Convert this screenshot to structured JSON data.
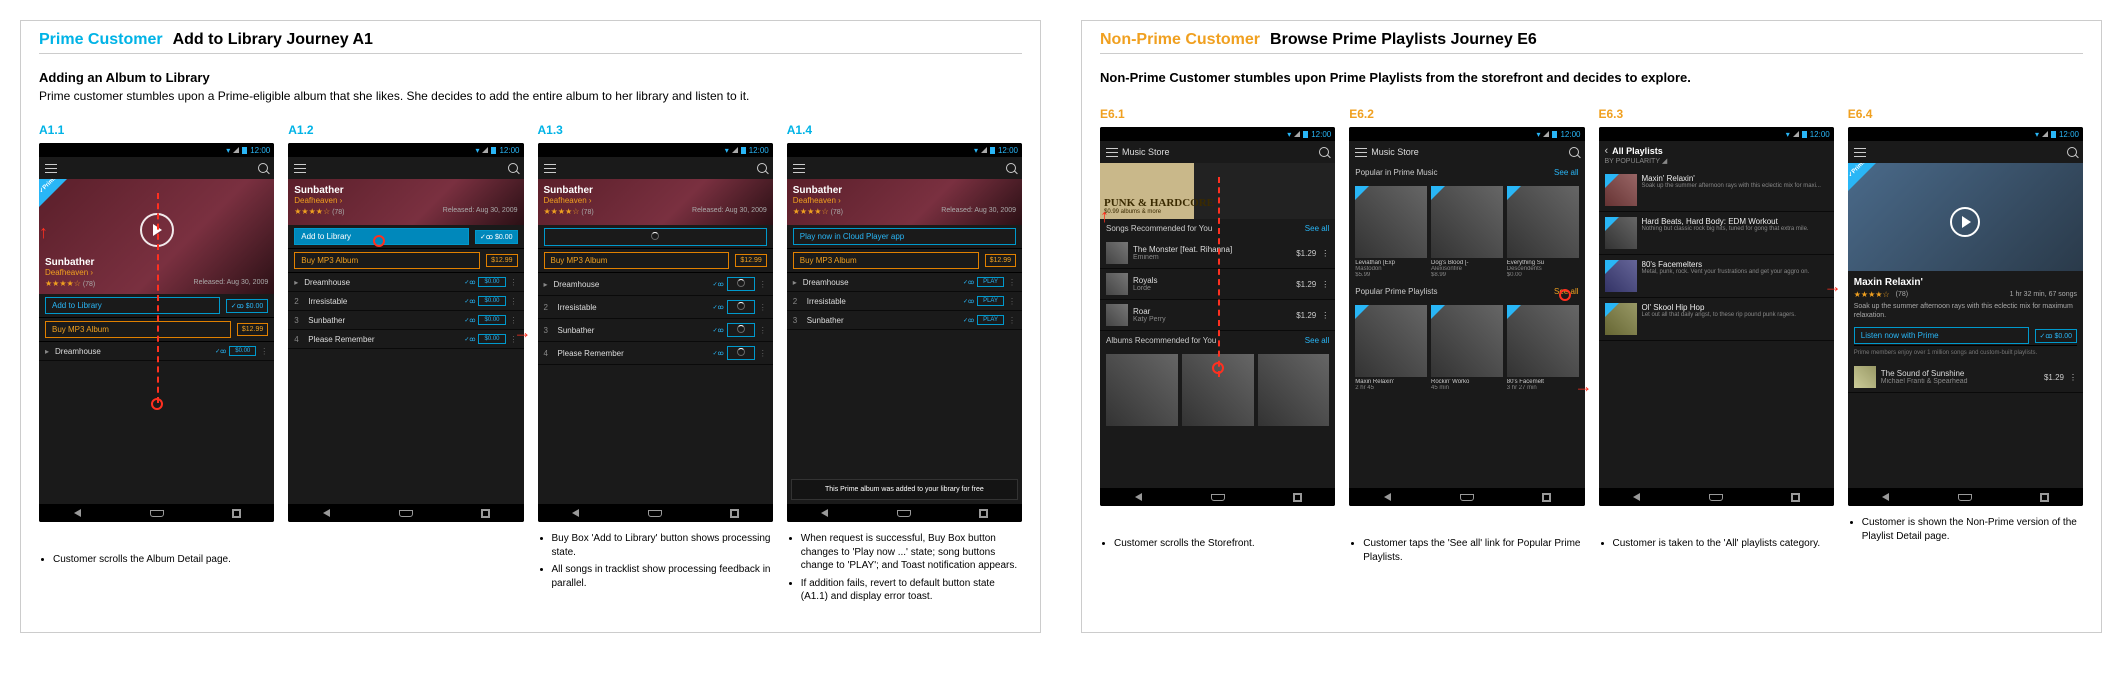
{
  "left": {
    "persona": "Prime Customer",
    "journey": "Add to Library Journey A1",
    "sub_heading": "Adding an Album to Library",
    "sub_desc": "Prime customer stumbles upon a Prime-eligible album that she likes. She decides to add the entire album to her library and listen to it.",
    "status_time": "12:00",
    "album": {
      "title": "Sunbather",
      "artist": "Deafheaven ›",
      "rating_count": "(78)",
      "released": "Released: Aug 30, 2009"
    },
    "add_to_library": "Add to Library",
    "buy_mp3": "Buy MP3 Album",
    "play_now": "Play now in Cloud Player app",
    "free_price": "$0.00",
    "album_price": "$12.99",
    "track_btn_price": "$0.00",
    "track_btn_play": "PLAY",
    "tracks": [
      "Dreamhouse",
      "Irresistable",
      "Sunbather",
      "Please Remember"
    ],
    "toast": "This Prime album was added to your library for free",
    "screens": [
      {
        "id": "A1.1",
        "notes": [
          "Customer scrolls the Album Detail page."
        ]
      },
      {
        "id": "A1.2",
        "notes": []
      },
      {
        "id": "A1.3",
        "notes": [
          "Buy Box 'Add to Library' button shows processing state.",
          "All songs in tracklist show processing feedback in parallel."
        ]
      },
      {
        "id": "A1.4",
        "notes": [
          "When request is successful, Buy Box button changes to 'Play now ...' state; song buttons change to 'PLAY'; and Toast notification appears.",
          "If addition fails, revert to default button state (A1.1) and display error toast."
        ]
      }
    ]
  },
  "right": {
    "persona": "Non-Prime Customer",
    "journey": "Browse Prime Playlists Journey E6",
    "sub_desc": "Non-Prime Customer stumbles upon Prime Playlists from the storefront and decides to explore.",
    "status_time": "12:00",
    "store_title": "Music Store",
    "banner_title": "PUNK & HARDCORE",
    "banner_sub": "$0.99 albums & more",
    "sec_songs_rec": "Songs Recommended for You",
    "sec_albums_rec": "Albums Recommended for You",
    "sec_popular_prime_music": "Popular in Prime Music",
    "sec_popular_prime_pl": "Popular Prime Playlists",
    "see_all": "See all",
    "songs": [
      {
        "t": "The Monster [feat. Rihanna]",
        "a": "Eminem",
        "p": "$1.29"
      },
      {
        "t": "Royals",
        "a": "Lorde",
        "p": "$1.29"
      },
      {
        "t": "Roar",
        "a": "Katy Perry",
        "p": "$1.29"
      }
    ],
    "prime_music_cards": [
      {
        "t": "Leviathan [Exp",
        "a": "Mastodon",
        "p": "$5.99"
      },
      {
        "t": "Dog's Blood [-",
        "a": "Alexisonfire",
        "p": "$8.99"
      },
      {
        "t": "Everything Su",
        "a": "Descendents",
        "p": "$0.00"
      }
    ],
    "prime_pl_cards": [
      {
        "t": "Maxin Relaxin'",
        "a": "2 hr 45"
      },
      {
        "t": "Rockin' Worko",
        "a": "45 min"
      },
      {
        "t": "80's Facemelt",
        "a": "3 hr 27 min"
      }
    ],
    "all_pl_title": "All Playlists",
    "all_pl_sort": "BY POPULARITY ◢",
    "playlists": [
      {
        "t": "Maxin' Relaxin'",
        "d": "Soak up the summer afternoon rays with this eclectic mix for maxi..."
      },
      {
        "t": "Hard Beats, Hard Body: EDM Workout",
        "d": "Nothing but classic rock big hits, tuned for gong that extra mile."
      },
      {
        "t": "80's Facemelters",
        "d": "Metal, punk, rock. Vent your frustrations and get your aggro on."
      },
      {
        "t": "Ol' Skool Hip Hop",
        "d": "Let out all that daily angst, to these rip pound punk ragers."
      }
    ],
    "detail": {
      "title": "Maxin Relaxin'",
      "rating_count": "(78)",
      "length": "1 hr 32 min, 67 songs",
      "desc": "Soak up the summer afternoon rays with this eclectic mix for maximum relaxation.",
      "cta": "Listen now with Prime",
      "cta_price": "$0.00",
      "foot": "Prime members enjoy over 1 million songs and custom-built playlists.",
      "rec_title": "The Sound of Sunshine",
      "rec_artist": "Michael Franti & Spearhead",
      "rec_price": "$1.29"
    },
    "screens": [
      {
        "id": "E6.1",
        "notes": [
          "Customer scrolls the Storefront."
        ]
      },
      {
        "id": "E6.2",
        "notes": [
          "Customer taps the 'See all' link for Popular Prime Playlists."
        ]
      },
      {
        "id": "E6.3",
        "notes": [
          "Customer is taken to the 'All' playlists category."
        ]
      },
      {
        "id": "E6.4",
        "notes": [
          "Customer is shown the Non-Prime version of the Playlist Detail page."
        ]
      }
    ]
  }
}
